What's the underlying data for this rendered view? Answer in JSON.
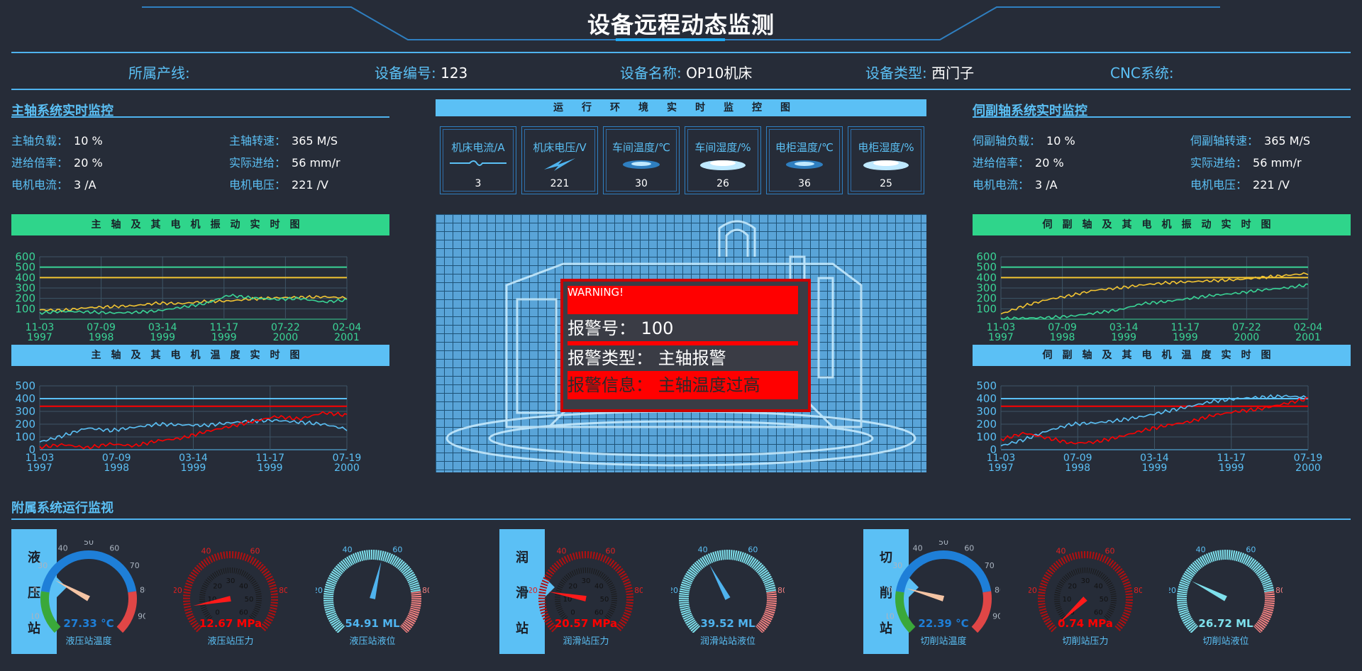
{
  "header": {
    "title": "设备远程动态监测"
  },
  "info": {
    "line": {
      "label": "所属产线:",
      "value": ""
    },
    "code": {
      "label": "设备编号:",
      "value": "123"
    },
    "name": {
      "label": "设备名称:",
      "value": "OP10机床"
    },
    "type": {
      "label": "设备类型:",
      "value": "西门子"
    },
    "cnc": {
      "label": "CNC系统:",
      "value": ""
    }
  },
  "spindle": {
    "title": "主轴系统实时监控",
    "items": [
      {
        "label": "主轴负载：",
        "value": "10 %"
      },
      {
        "label": "主轴转速：",
        "value": "365 M/S"
      },
      {
        "label": "进给倍率：",
        "value": "20 %"
      },
      {
        "label": "实际进给：",
        "value": "56 mm/r"
      },
      {
        "label": "电机电流：",
        "value": "3 /A"
      },
      {
        "label": "电机电压：",
        "value": "221 /V"
      }
    ],
    "vib_title": "主轴及其电机振动实时图",
    "temp_title": "主轴及其电机温度实时图"
  },
  "servo": {
    "title": "伺副轴系统实时监控",
    "items": [
      {
        "label": "伺副轴负载：",
        "value": "10 %"
      },
      {
        "label": "伺副轴转速：",
        "value": "365 M/S"
      },
      {
        "label": "进给倍率：",
        "value": "20 %"
      },
      {
        "label": "实际进给：",
        "value": "56 mm/r"
      },
      {
        "label": "电机电流：",
        "value": "3 /A"
      },
      {
        "label": "电机电压：",
        "value": "221 /V"
      }
    ],
    "vib_title": "伺副轴及其电机振动实时图",
    "temp_title": "伺副轴及其电机温度实时图"
  },
  "env": {
    "title": "运行环境实时监控图",
    "cards": [
      {
        "label": "机床电流/A",
        "value": "3",
        "icon": "current-wave-icon"
      },
      {
        "label": "机床电压/V",
        "value": "221",
        "icon": "lightning-icon"
      },
      {
        "label": "车间温度/℃",
        "value": "30",
        "icon": "thermo-disc-icon"
      },
      {
        "label": "车间湿度/%",
        "value": "26",
        "icon": "humidity-disc-icon"
      },
      {
        "label": "电柜温度/℃",
        "value": "36",
        "icon": "thermo-disc-icon"
      },
      {
        "label": "电柜湿度/%",
        "value": "25",
        "icon": "humidity-disc-icon"
      }
    ]
  },
  "alarm": {
    "warning": "WARNING!",
    "no_label": "报警号：",
    "no_value": "100",
    "type_label": "报警类型：",
    "type_value": "主轴报警",
    "msg_label": "报警信息：",
    "msg_value": "主轴温度过高"
  },
  "aux": {
    "title": "附属系统运行监视",
    "stations": [
      {
        "name": [
          "液",
          "压",
          "站"
        ]
      },
      {
        "name": [
          "润",
          "滑",
          "站"
        ]
      },
      {
        "name": [
          "切",
          "削",
          "站"
        ]
      }
    ],
    "gauges": [
      {
        "kind": "temp",
        "value": 27.33,
        "display": "27.33 °C",
        "name": "液压站温度",
        "color": "#1e7fd8"
      },
      {
        "kind": "pressure",
        "value": 12.67,
        "display": "12.67 MPa",
        "name": "液压站压力",
        "color": "#ff0000"
      },
      {
        "kind": "level",
        "value": 54.91,
        "display": "54.91 ML",
        "name": "液压站液位",
        "color": "#4fb3ee"
      },
      {
        "kind": "pressure",
        "value": 20.57,
        "display": "20.57 MPa",
        "name": "润滑站压力",
        "color": "#ff0000"
      },
      {
        "kind": "level",
        "value": 39.52,
        "display": "39.52 ML",
        "name": "润滑站站液位",
        "color": "#4fb3ee"
      },
      {
        "kind": "temp",
        "value": 22.39,
        "display": "22.39 °C",
        "name": "切削站温度",
        "color": "#1e7fd8"
      },
      {
        "kind": "pressure",
        "value": 0.74,
        "display": "0.74 MPa",
        "name": "切削站压力",
        "color": "#ff0000"
      },
      {
        "kind": "level",
        "value": 26.72,
        "display": "26.72 ML",
        "name": "切削站液位",
        "color": "#7ee0ec"
      }
    ],
    "scales": {
      "temp": [
        "0",
        "10",
        "20",
        "30",
        "40",
        "50",
        "60",
        "70",
        "80",
        "90",
        "100"
      ],
      "pressure_outer": [
        "0",
        "20",
        "40",
        "60",
        "80",
        "100"
      ],
      "pressure_inner": [
        "0",
        "10",
        "20",
        "30",
        "40",
        "50",
        "60"
      ],
      "level": [
        "0",
        "20",
        "40",
        "60",
        "80",
        "100"
      ]
    }
  },
  "colors": {
    "accent": "#5bc0f5",
    "green_band": "#2fd58b",
    "alarm": "#ff0000",
    "vib_line_a": "#f3c532",
    "vib_line_b": "#3ad496",
    "temp_line_a": "#5bc0f5",
    "temp_line_b": "#ff0000"
  },
  "chart_data": [
    {
      "id": "spindle-vibration",
      "type": "line",
      "x": [
        "11-03 1997",
        "07-09 1998",
        "03-14 1999",
        "11-17 1999",
        "07-22 2000",
        "02-04 2001"
      ],
      "ylim": [
        0,
        600
      ],
      "yticks": [
        100,
        200,
        300,
        400,
        500,
        600
      ],
      "thresholds": [
        {
          "value": 400,
          "color": "#f3c532"
        },
        {
          "value": 500,
          "color": "#3ad496"
        }
      ],
      "series": [
        {
          "color": "#f3c532",
          "values": [
            90,
            85,
            110,
            120,
            130,
            155,
            150,
            170,
            175,
            195,
            205,
            210,
            215,
            205
          ]
        },
        {
          "color": "#3ad496",
          "values": [
            60,
            75,
            70,
            60,
            65,
            80,
            115,
            150,
            230,
            205,
            190,
            200,
            165,
            185
          ]
        }
      ]
    },
    {
      "id": "spindle-temperature",
      "type": "line",
      "x": [
        "11-03 1997",
        "07-09 1998",
        "03-14 1999",
        "11-17 1999",
        "07-19 2000"
      ],
      "ylim": [
        0,
        500
      ],
      "yticks": [
        0,
        100,
        200,
        300,
        400,
        500
      ],
      "thresholds": [
        {
          "value": 400,
          "color": "#5bc0f5"
        },
        {
          "value": 340,
          "color": "#ff0000"
        }
      ],
      "series": [
        {
          "color": "#5bc0f5",
          "values": [
            60,
            110,
            170,
            150,
            175,
            200,
            195,
            190,
            210,
            225,
            230,
            215,
            200,
            160
          ]
        },
        {
          "color": "#ff0000",
          "values": [
            20,
            40,
            15,
            45,
            30,
            70,
            90,
            140,
            180,
            220,
            260,
            240,
            290,
            270
          ]
        }
      ]
    },
    {
      "id": "servo-vibration",
      "type": "line",
      "x": [
        "11-03 1997",
        "07-09 1998",
        "03-14 1999",
        "11-17 1999",
        "07-22 2000",
        "02-04 2001"
      ],
      "ylim": [
        0,
        600
      ],
      "yticks": [
        100,
        200,
        300,
        400,
        500,
        600
      ],
      "thresholds": [
        {
          "value": 400,
          "color": "#f3c532"
        },
        {
          "value": 500,
          "color": "#3ad496"
        }
      ],
      "series": [
        {
          "color": "#f3c532",
          "values": [
            50,
            130,
            190,
            230,
            280,
            300,
            330,
            350,
            360,
            370,
            380,
            400,
            420,
            440
          ]
        },
        {
          "color": "#3ad496",
          "values": [
            5,
            10,
            15,
            30,
            60,
            90,
            150,
            170,
            200,
            230,
            250,
            280,
            300,
            330
          ]
        }
      ]
    },
    {
      "id": "servo-temperature",
      "type": "line",
      "x": [
        "11-03 1997",
        "07-09 1998",
        "03-14 1999",
        "11-17 1999",
        "07-19 2000"
      ],
      "ylim": [
        0,
        500
      ],
      "yticks": [
        0,
        100,
        200,
        300,
        400,
        500
      ],
      "thresholds": [
        {
          "value": 400,
          "color": "#5bc0f5"
        },
        {
          "value": 340,
          "color": "#ff0000"
        }
      ],
      "series": [
        {
          "color": "#5bc0f5",
          "values": [
            30,
            80,
            150,
            200,
            210,
            230,
            260,
            300,
            340,
            380,
            400,
            410,
            420,
            410
          ]
        },
        {
          "color": "#ff0000",
          "values": [
            80,
            130,
            90,
            50,
            60,
            100,
            150,
            190,
            220,
            270,
            300,
            320,
            360,
            400
          ]
        }
      ]
    }
  ]
}
